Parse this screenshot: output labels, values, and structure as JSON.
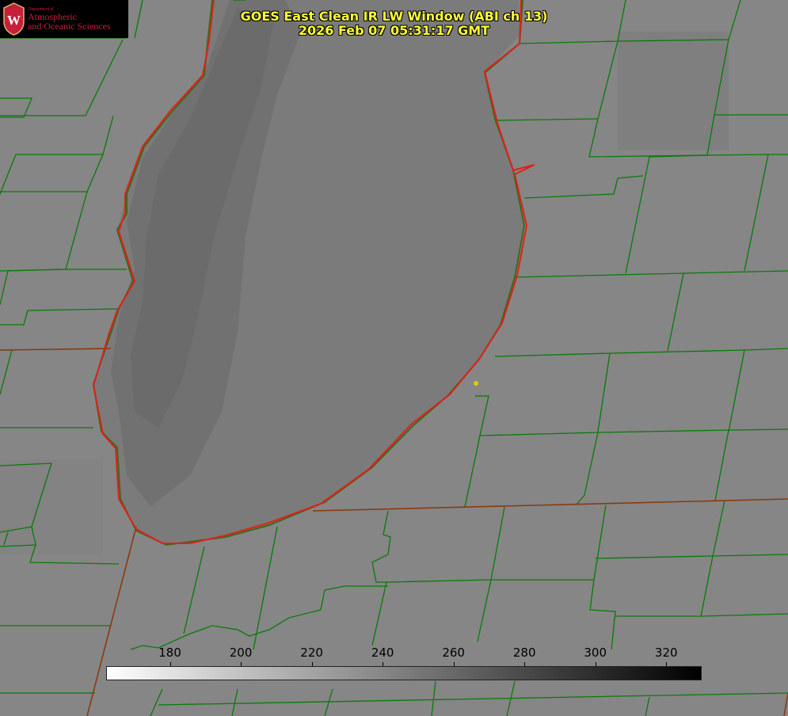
{
  "title": {
    "line1": "GOES East Clean IR LW Window (ABI ch 13)",
    "line2": "2026 Feb 07 05:31:17 GMT"
  },
  "logo": {
    "department_prefix": "Department of",
    "line1": "Atmospheric",
    "line2": "and Oceanic Sciences"
  },
  "colorbar": {
    "min": 162,
    "max": 330,
    "ticks": [
      180,
      200,
      220,
      240,
      260,
      280,
      300,
      320
    ],
    "palette": "white-to-black"
  },
  "colors": {
    "county_lines": "#0a7a0a",
    "state_lines": "#8a3a10",
    "shoreline": "#e0201a",
    "marker": "#e6c800",
    "title": "#ffff33"
  }
}
